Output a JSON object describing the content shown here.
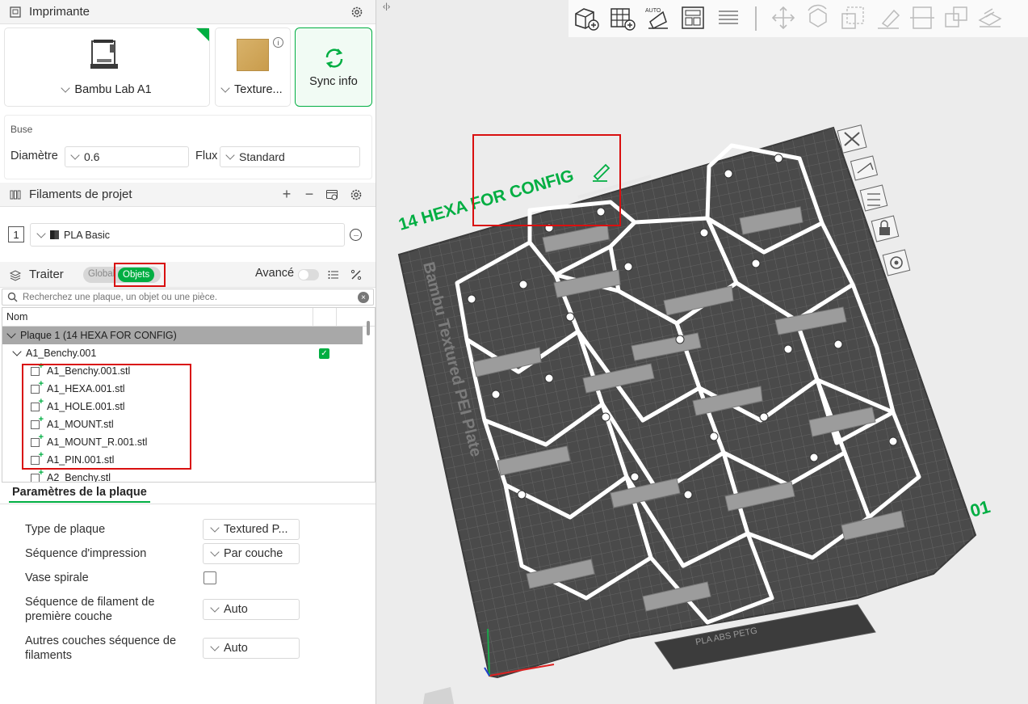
{
  "printer": {
    "section_title": "Imprimante",
    "printer_name": "Bambu Lab A1",
    "plate_name": "Texture...",
    "sync_label": "Sync info"
  },
  "nozzle": {
    "title": "Buse",
    "diameter_label": "Diamètre",
    "diameter_value": "0.6",
    "flow_label": "Flux",
    "flow_value": "Standard"
  },
  "filaments": {
    "section_title": "Filaments de projet",
    "items": [
      {
        "index": "1",
        "name": "PLA Basic"
      }
    ]
  },
  "process": {
    "section_title": "Traiter",
    "tab_global": "Global",
    "tab_objects": "Objets",
    "advanced_label": "Avancé",
    "advanced_on": false
  },
  "search": {
    "placeholder": "Recherchez une plaque, un objet ou une pièce."
  },
  "tree": {
    "column_name": "Nom",
    "plate_label": "Plaque 1 (14 HEXA FOR CONFIG)",
    "object_label": "A1_Benchy.001",
    "parts": [
      "A1_Benchy.001.stl",
      "A1_HEXA.001.stl",
      "A1_HOLE.001.stl",
      "A1_MOUNT.stl",
      "A1_MOUNT_R.001.stl",
      "A1_PIN.001.stl"
    ],
    "next_object": "A2_Benchy.stl"
  },
  "plate_params": {
    "tab_label": "Paramètres de la plaque",
    "rows": [
      {
        "label": "Type de plaque",
        "value": "Textured P..."
      },
      {
        "label": "Séquence d'impression",
        "value": "Par couche"
      },
      {
        "label": "Vase spirale",
        "value": ""
      },
      {
        "label": "Séquence de filament de première couche",
        "value": "Auto"
      },
      {
        "label": "Autres couches séquence de filaments",
        "value": "Auto"
      }
    ]
  },
  "viewport": {
    "plate_title": "14 HEXA FOR CONFIG",
    "plate_number": "01",
    "bed_label": "Bambu Textured PEI Plate",
    "bed_footer": "PLA ABS PETG",
    "collapse_glyph": "‹|›",
    "toolbar_icons": [
      "add-object-icon",
      "add-plate-icon",
      "auto-orient-icon",
      "arrange-icon",
      "layers-icon",
      "move-icon",
      "rotate-icon",
      "scale-icon",
      "lay-on-face-icon",
      "cut-icon",
      "boolean-icon",
      "emboss-icon"
    ]
  },
  "colors": {
    "accent": "#00ae42",
    "annotation_red": "#d90f0f",
    "bed_dark": "#4a4a4a",
    "hex_frame": "#ffffff"
  }
}
